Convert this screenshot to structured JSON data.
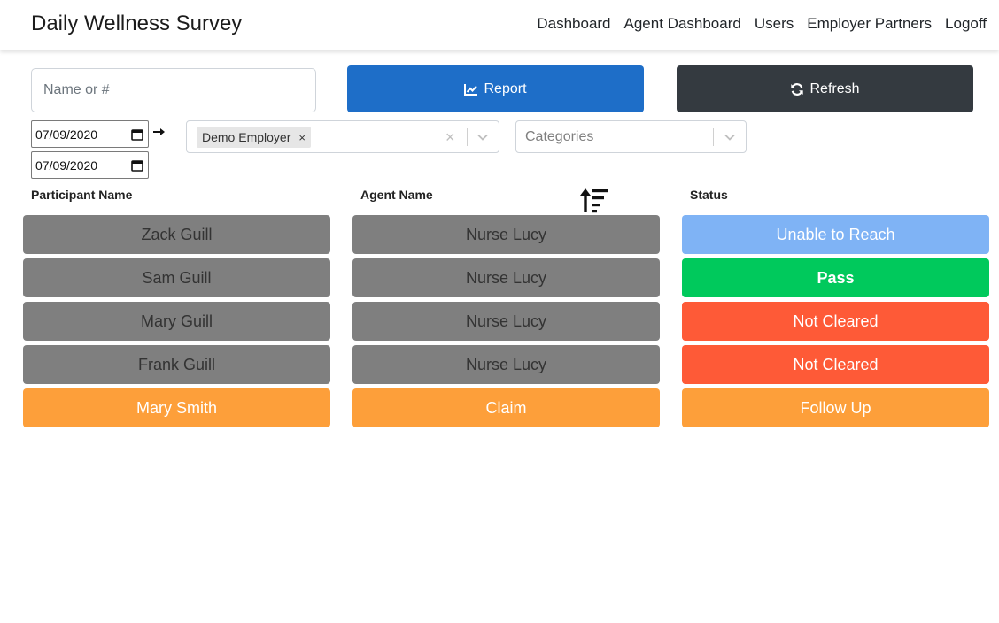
{
  "header": {
    "title": "Daily Wellness Survey",
    "nav": [
      "Dashboard",
      "Agent Dashboard",
      "Users",
      "Employer Partners",
      "Logoff"
    ]
  },
  "toolbar": {
    "search_placeholder": "Name or #",
    "report_label": "Report",
    "refresh_label": "Refresh",
    "date_from": "07/09/2020",
    "date_to": "07/09/2020",
    "employer_chip": "Demo Employer",
    "categories_placeholder": "Categories"
  },
  "columns": {
    "participant": "Participant Name",
    "agent": "Agent Name",
    "status": "Status"
  },
  "rows": [
    {
      "participant": "Zack Guill",
      "agent": "Nurse Lucy",
      "status": "Unable to Reach"
    },
    {
      "participant": "Sam Guill",
      "agent": "Nurse Lucy",
      "status": "Pass"
    },
    {
      "participant": "Mary Guill",
      "agent": "Nurse Lucy",
      "status": "Not Cleared"
    },
    {
      "participant": "Frank Guill",
      "agent": "Nurse Lucy",
      "status": "Not Cleared"
    },
    {
      "participant": "Mary Smith",
      "agent": "Claim",
      "status": "Follow Up"
    }
  ],
  "colors": {
    "report": "#1e6ec8",
    "refresh": "#343a40",
    "assigned_row": "#7f7f7f",
    "unclaimed_row": "#fd9f3a",
    "unable_to_reach": "#7fb3f5",
    "pass": "#00c95c",
    "not_cleared": "#fe5a37",
    "follow_up": "#fd9f3a"
  },
  "icons": {
    "report": "chart-line-icon",
    "refresh": "refresh-icon",
    "date": "calendar-icon",
    "range": "arrow-right-icon",
    "sort": "sort-descending-icon"
  }
}
